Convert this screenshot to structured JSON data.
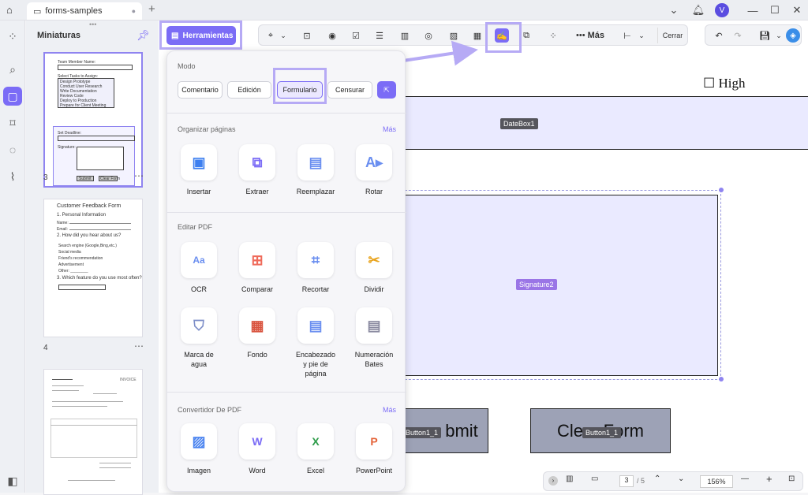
{
  "window": {
    "tab_title": "forms-samples",
    "add_tab": "+",
    "avatar_initial": "V"
  },
  "sidebar": {
    "title": "Miniaturas",
    "pages": [
      {
        "num": "3"
      },
      {
        "num": "4"
      }
    ]
  },
  "thumb3": {
    "l1": "Team Member Name:",
    "l2": "Select Tasks to Assign:",
    "l3": "Design Prototype",
    "l4": "Conduct User Research",
    "l5": "Write Documentation",
    "l6": "Review Code",
    "l7": "Deploy to Production",
    "l8": "Prepare for Client Meeting",
    "l9": "Set Deadline:",
    "l10": "Signature:",
    "l11": "Submit",
    "l12": "Clear Form"
  },
  "thumb4": {
    "title": "Customer Feedback Form",
    "h1": "1. Personal Information",
    "name": "Name:",
    "email": "Email:",
    "h2": "2. How did you hear about us?",
    "o1": "Search engine (Google,Bing,etc.)",
    "o2": "Social media",
    "o3": "Friend's recommendation",
    "o4": "Advertisement",
    "o5": "Other: ________",
    "h3": "3. Which feature do you use most often?"
  },
  "thumb5": {
    "invoice": "INVOICE"
  },
  "toolbar": {
    "herramientas": "Herramientas",
    "mas": "Más",
    "cerrar": "Cerrar"
  },
  "document": {
    "high_label": "☐ High",
    "datebox_tag": "DateBox1",
    "signature_tag": "Signature2",
    "submit_text": "bmit",
    "submit_tag": "Button1_1",
    "clear_text": "Clear Form",
    "clear_tag": "Button1_1"
  },
  "panel": {
    "modo": "Modo",
    "modes": [
      "Comentario",
      "Edición",
      "Formulario",
      "Censurar"
    ],
    "organizar": "Organizar páginas",
    "organizar_mas": "Más",
    "org_tools": [
      "Insertar",
      "Extraer",
      "Reemplazar",
      "Rotar"
    ],
    "editar": "Editar PDF",
    "edit_tools": [
      "OCR",
      "Comparar",
      "Recortar",
      "Dividir",
      "Marca de agua",
      "Fondo",
      "Encabezado y pie de página",
      "Numeración Bates"
    ],
    "convertidor": "Convertidor De PDF",
    "conv_mas": "Más",
    "conv_tools": [
      "Imagen",
      "Word",
      "Excel",
      "PowerPoint"
    ]
  },
  "bottombar": {
    "page_current": "3",
    "page_total": "/ 5",
    "zoom": "156%"
  },
  "colors": {
    "accent": "#7b6cf6",
    "field_fill": "#eaeaff",
    "button_fill": "#9da2b6"
  }
}
